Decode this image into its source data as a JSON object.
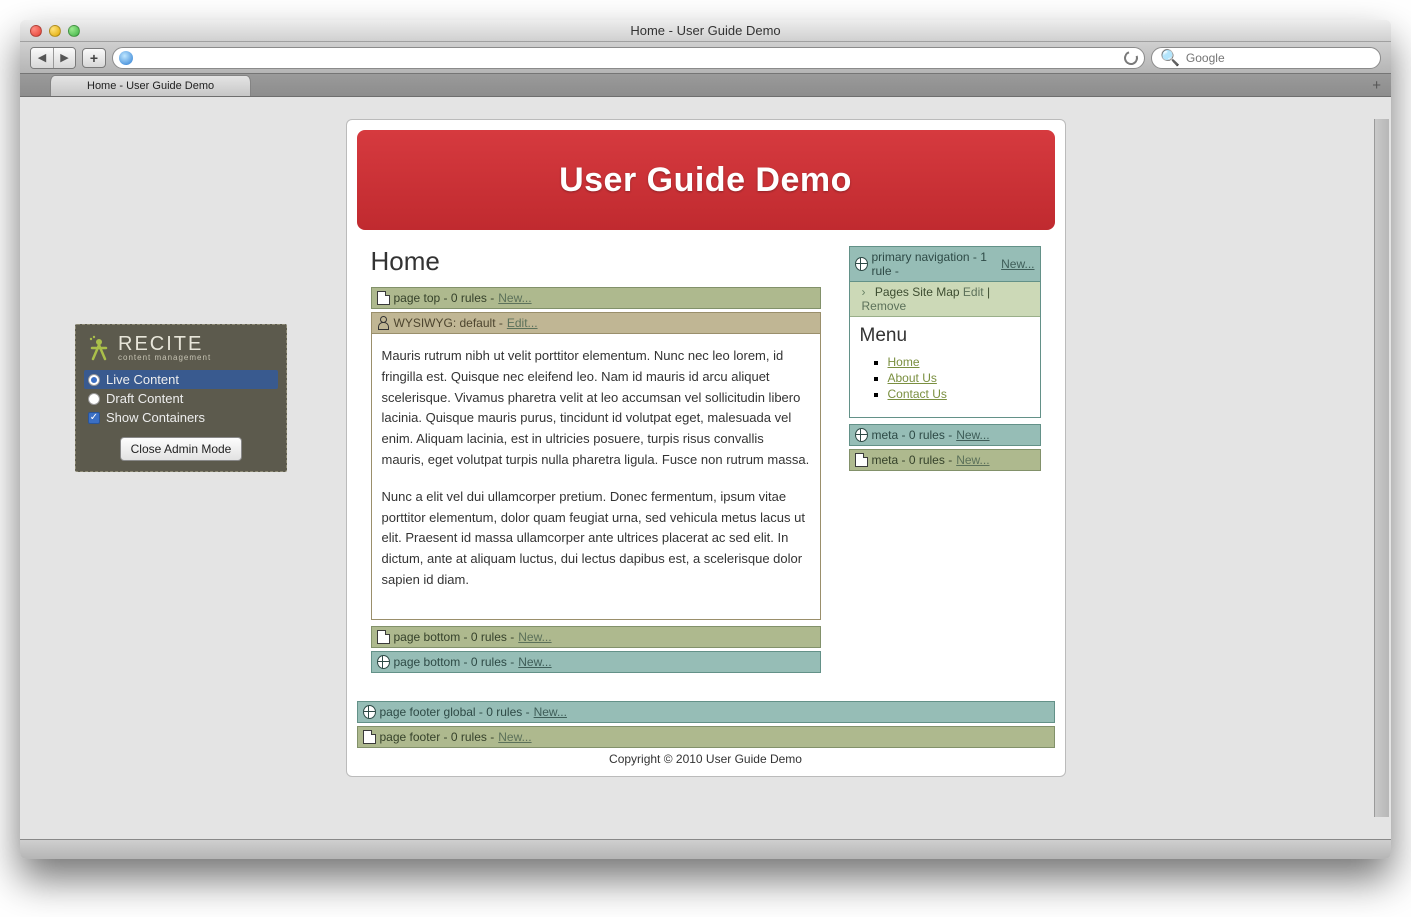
{
  "window": {
    "title": "Home - User Guide Demo",
    "tab_title": "Home - User Guide Demo",
    "search_placeholder": "Google"
  },
  "admin": {
    "brand": "RECITE",
    "brand_sub": "content management",
    "options": {
      "live": "Live Content",
      "draft": "Draft Content",
      "show": "Show Containers"
    },
    "close_button": "Close Admin Mode"
  },
  "banner": "User Guide Demo",
  "page": {
    "heading": "Home",
    "bars": {
      "page_top": {
        "label": "page top - 0 rules -",
        "action": "New..."
      },
      "wysiwyg": {
        "label": "WYSIWYG: default -",
        "action": "Edit..."
      },
      "page_bottom_doc": {
        "label": "page bottom - 0 rules -",
        "action": "New..."
      },
      "page_bottom_globe": {
        "label": "page bottom - 0 rules -",
        "action": "New..."
      }
    },
    "body_p1": "Mauris rutrum nibh ut velit porttitor elementum. Nunc nec leo lorem, id fringilla est. Quisque nec eleifend leo. Nam id mauris id arcu aliquet scelerisque. Vivamus pharetra velit at leo accumsan vel sollicitudin libero lacinia. Quisque mauris purus, tincidunt id volutpat eget, malesuada vel enim. Aliquam lacinia, est in ultricies posuere, turpis risus convallis mauris, eget volutpat turpis nulla pharetra ligula. Fusce non rutrum massa.",
    "body_p2": "Nunc a elit vel dui ullamcorper pretium. Donec fermentum, ipsum vitae porttitor elementum, dolor quam feugiat urna, sed vehicula metus lacus ut elit. Praesent id massa ullamcorper ante ultrices placerat ac sed elit. In dictum, ante at aliquam luctus, dui lectus dapibus est, a scelerisque dolor sapien id diam."
  },
  "sidebar": {
    "primary_nav": {
      "label": "primary navigation - 1 rule -",
      "action": "New..."
    },
    "sitemap": {
      "label": "Pages Site Map",
      "edit": "Edit",
      "sep": "|",
      "remove": "Remove"
    },
    "menu_title": "Menu",
    "menu": {
      "home": "Home",
      "about": "About Us",
      "contact": "Contact Us"
    },
    "meta_globe": {
      "label": "meta - 0 rules -",
      "action": "New..."
    },
    "meta_doc": {
      "label": "meta - 0 rules -",
      "action": "New..."
    }
  },
  "footer": {
    "global": {
      "label": "page footer global - 0 rules -",
      "action": "New..."
    },
    "local": {
      "label": "page footer - 0 rules -",
      "action": "New..."
    },
    "copyright": "Copyright © 2010 User Guide Demo"
  }
}
